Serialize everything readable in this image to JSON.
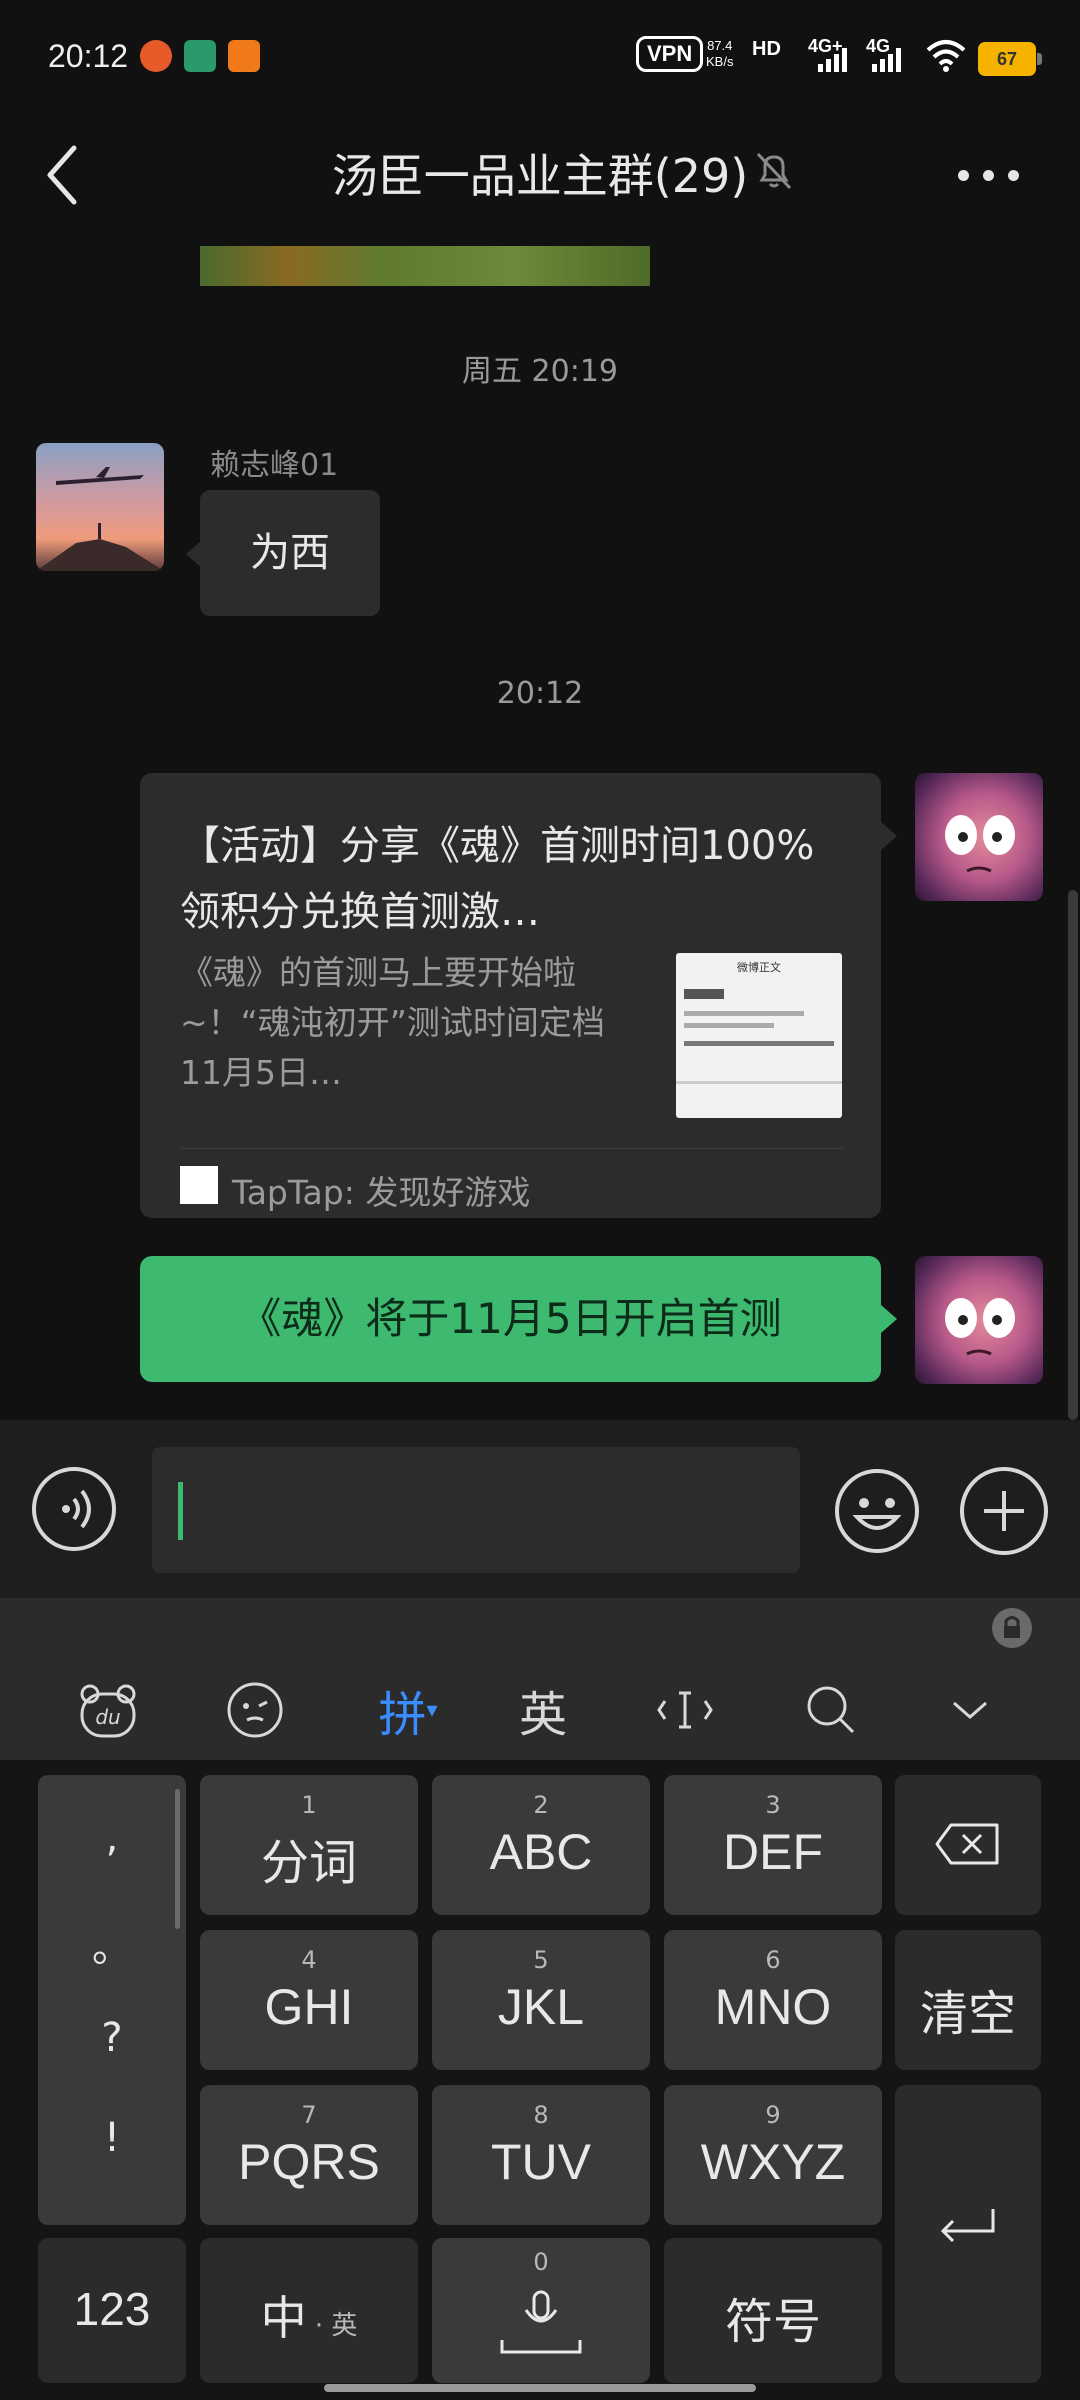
{
  "status_bar": {
    "time": "20:12",
    "vpn": "VPN",
    "speed_value": "87.4",
    "speed_unit": "KB/s",
    "hd": "HD",
    "net1": "4G+",
    "net2": "4G",
    "battery": "67"
  },
  "header": {
    "title": "汤臣一品业主群(29)"
  },
  "chat": {
    "timestamp_1": "周五 20:19",
    "sender_name": "赖志峰01",
    "incoming_message": "为西",
    "timestamp_2": "20:12",
    "card": {
      "title": "【活动】分享《魂》首测时间100%领积分兑换首测激…",
      "description": "《魂》的首测马上要开始啦~！“魂沌初开”测试时间定档11月5日…",
      "thumbnail_title": "微博正文",
      "source": "TapTap: 发现好游戏"
    },
    "outgoing_message": "《魂》将于11月5日开启首测"
  },
  "keyboard": {
    "toolbar": {
      "pinyin": "拼",
      "english": "英"
    },
    "punctuation": [
      ",",
      "。",
      "?",
      "!"
    ],
    "keys": [
      {
        "num": "1",
        "label": "分词"
      },
      {
        "num": "2",
        "label": "ABC"
      },
      {
        "num": "3",
        "label": "DEF"
      },
      {
        "num": "4",
        "label": "GHI"
      },
      {
        "num": "5",
        "label": "JKL"
      },
      {
        "num": "6",
        "label": "MNO"
      },
      {
        "num": "7",
        "label": "PQRS"
      },
      {
        "num": "8",
        "label": "TUV"
      },
      {
        "num": "9",
        "label": "WXYZ"
      }
    ],
    "clear": "清空",
    "num_switch": "123",
    "zh_key": "中",
    "zh_key_sub": "英",
    "space_num": "0",
    "symbols": "符号"
  }
}
